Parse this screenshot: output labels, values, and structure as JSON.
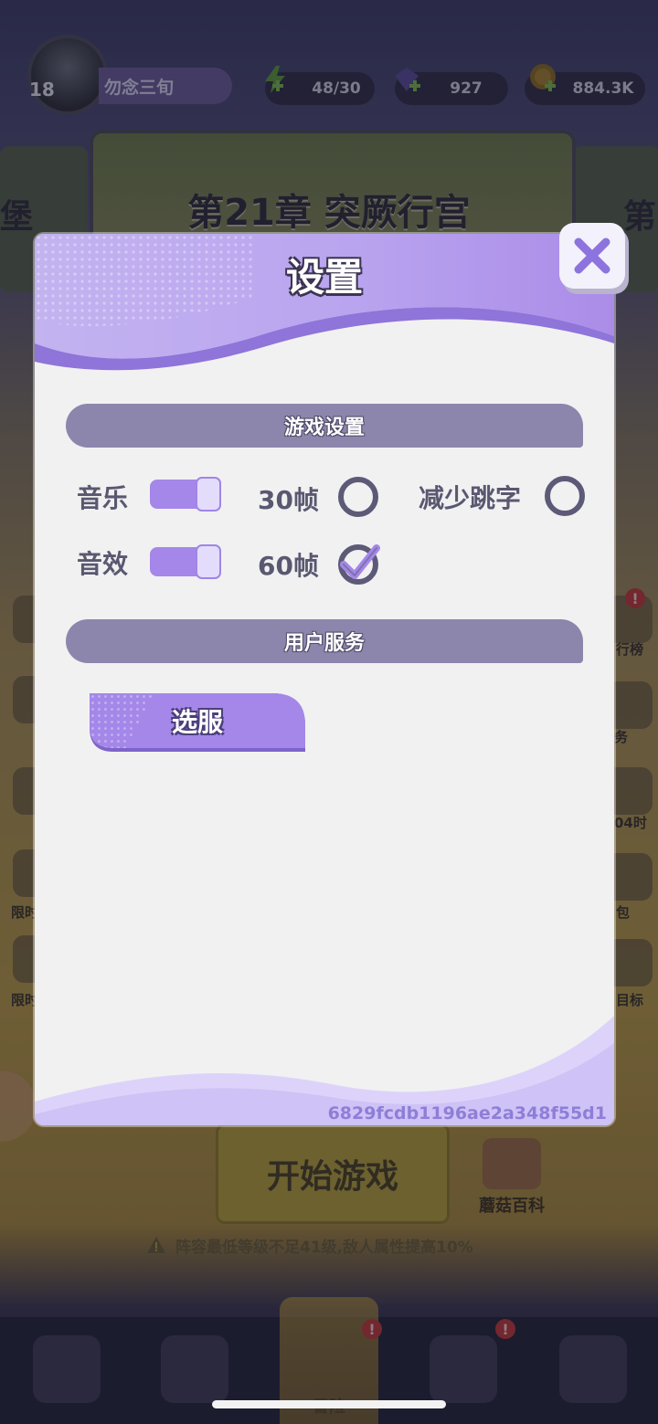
{
  "player": {
    "level": "18",
    "nickname": "勿念三旬"
  },
  "resources": {
    "energy": "48/30",
    "gems": "927",
    "coins": "884.3K"
  },
  "chapter": {
    "title": "第21章 突厥行宫",
    "left_partial": "堡",
    "right_partial": "第"
  },
  "side_labels": {
    "right": [
      "行榜",
      "务",
      "04时",
      "包",
      "目标"
    ],
    "left": [
      "限时",
      "限时"
    ]
  },
  "main": {
    "start_button": "开始游戏",
    "wiki_label": "蘑菇百科",
    "warning": "阵容最低等级不足41级,敌人属性提高10%"
  },
  "bottom_nav": {
    "active_label": "冒险"
  },
  "dialog": {
    "title": "设置",
    "game_settings": {
      "header": "游戏设置",
      "music_label": "音乐",
      "music_on": true,
      "sfx_label": "音效",
      "sfx_on": true,
      "fps30_label": "30帧",
      "fps30_selected": false,
      "fps60_label": "60帧",
      "fps60_selected": true,
      "reduce_label": "减少跳字",
      "reduce_selected": false
    },
    "user_services": {
      "header": "用户服务",
      "select_server_label": "选服"
    },
    "uid": "6829fcdb1196ae2a348f55d1"
  },
  "colors": {
    "accent_purple": "#a487e8",
    "section_bar": "#8c86ac",
    "dialog_bg": "#f1f1f2"
  }
}
